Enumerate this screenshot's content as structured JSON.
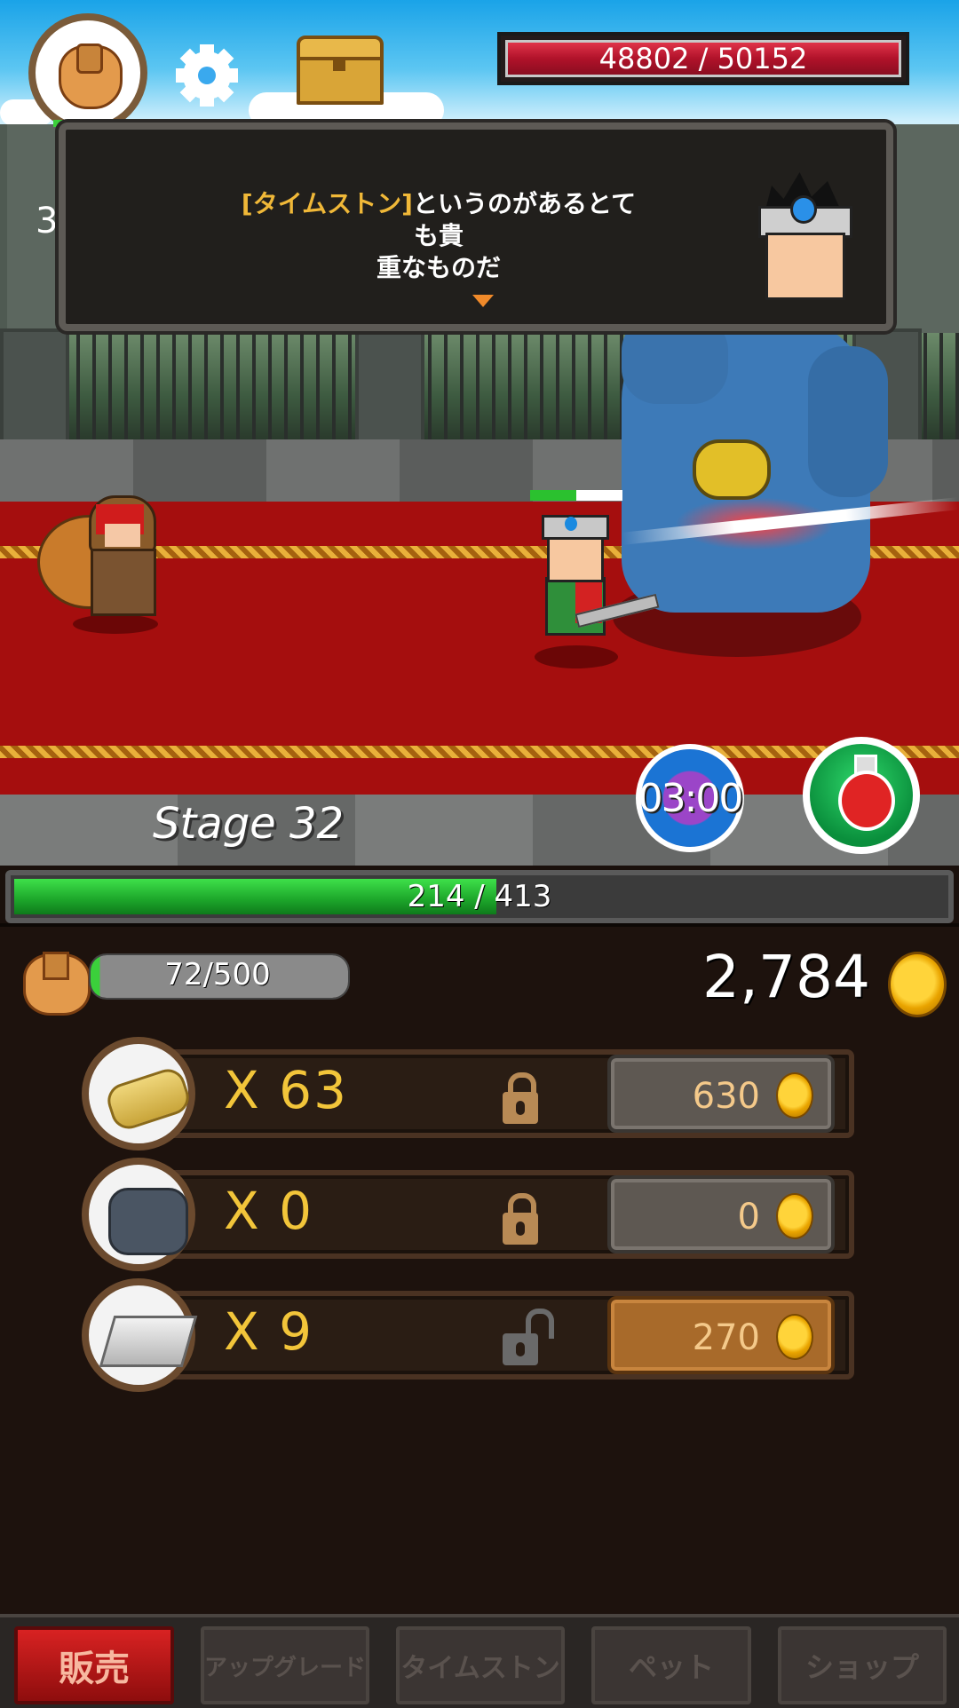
{
  "top_bar": {
    "bag_button": "bag-icon",
    "settings_button": "gear-icon",
    "chest_button": "treasure-chest-icon",
    "boss_hp": "48802 / 50152"
  },
  "side_counter": "3",
  "dialog": {
    "highlight": "[タイムストン]",
    "text_line1_rest": "というのがあるとても貴",
    "text_line2": "重なものだ"
  },
  "stage": {
    "label": "Stage 32"
  },
  "skills": {
    "timer": "03:00",
    "potion": "potion-icon"
  },
  "player_hp": {
    "text": "214 / 413",
    "fraction": 0.518
  },
  "inventory": {
    "capacity_text": "72/500",
    "capacity_fraction": 0.144,
    "gold": "2,784",
    "items": [
      {
        "name": "log",
        "count": "X 63",
        "value": "630",
        "locked": true
      },
      {
        "name": "coal",
        "count": "X 0",
        "value": "0",
        "locked": true
      },
      {
        "name": "iron",
        "count": "X 9",
        "value": "270",
        "locked": false
      }
    ]
  },
  "tabs": [
    {
      "label": "販売",
      "active": true
    },
    {
      "label": "アップグレード",
      "active": false
    },
    {
      "label": "タイムストン",
      "active": false
    },
    {
      "label": "ペット",
      "active": false
    },
    {
      "label": "ショップ",
      "active": false
    }
  ],
  "colors": {
    "accent_gold": "#f2c53a",
    "hp_red": "#b0122a",
    "hp_green": "#1ca52a",
    "tab_active": "#d82222"
  }
}
